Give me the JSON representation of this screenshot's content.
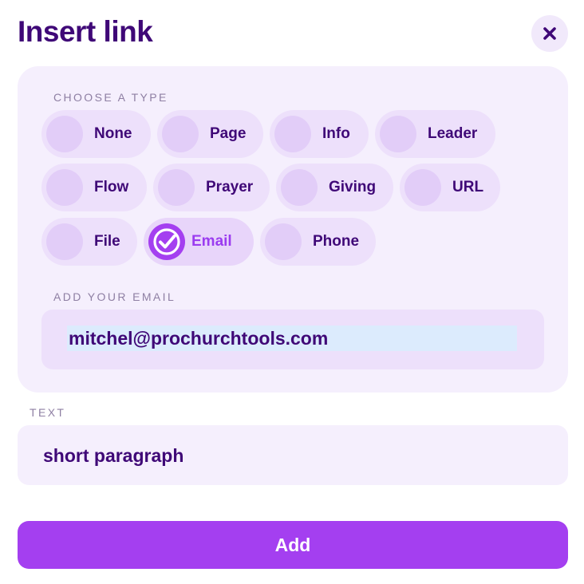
{
  "dialog": {
    "title": "Insert link",
    "close_icon": "close-icon"
  },
  "type_section": {
    "label": "CHOOSE A TYPE",
    "selected": "Email",
    "options": [
      {
        "label": "None"
      },
      {
        "label": "Page"
      },
      {
        "label": "Info"
      },
      {
        "label": "Leader"
      },
      {
        "label": "Flow"
      },
      {
        "label": "Prayer"
      },
      {
        "label": "Giving"
      },
      {
        "label": "URL"
      },
      {
        "label": "File"
      },
      {
        "label": "Email",
        "icon": "check-circle-icon"
      },
      {
        "label": "Phone"
      }
    ]
  },
  "email_section": {
    "label": "ADD YOUR EMAIL",
    "value": "mitchel@prochurchtools.com"
  },
  "text_section": {
    "label": "TEXT",
    "value": "short paragraph"
  },
  "actions": {
    "add_label": "Add"
  },
  "colors": {
    "primary": "#a43ff0",
    "title": "#3f0877",
    "panel": "#f5effd",
    "chip": "#ede0fb"
  }
}
